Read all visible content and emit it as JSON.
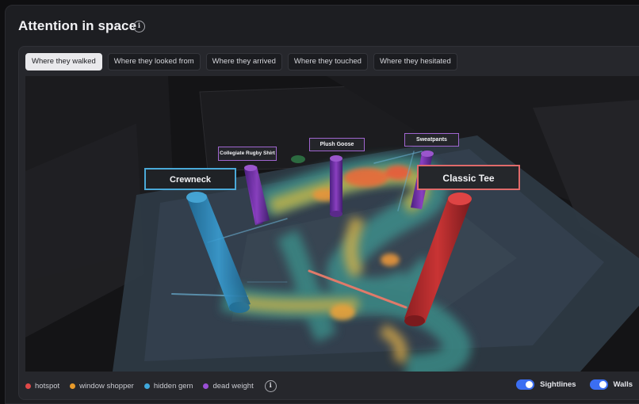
{
  "header": {
    "title": "Attention in space",
    "info_icon": "info-icon"
  },
  "tabs": [
    {
      "label": "Where they walked",
      "active": true
    },
    {
      "label": "Where they looked from",
      "active": false
    },
    {
      "label": "Where they arrived",
      "active": false
    },
    {
      "label": "Where they touched",
      "active": false
    },
    {
      "label": "Where they hesitated",
      "active": false
    }
  ],
  "scene": {
    "products": [
      {
        "label": "Crewneck",
        "category": "hidden gem",
        "color": "#3aa0d6"
      },
      {
        "label": "Collegiate Rugby Shirt",
        "category": "dead weight",
        "color": "#8a3fc0"
      },
      {
        "label": "Plush Goose",
        "category": "dead weight",
        "color": "#8a3fc0"
      },
      {
        "label": "Sweatpants",
        "category": "dead weight",
        "color": "#8a3fc0"
      },
      {
        "label": "Classic Tee",
        "category": "hotspot",
        "color": "#d64545"
      }
    ]
  },
  "legend": {
    "items": [
      {
        "label": "hotspot",
        "color": "#e04848"
      },
      {
        "label": "window shopper",
        "color": "#e89a2a"
      },
      {
        "label": "hidden gem",
        "color": "#3fa8dc"
      },
      {
        "label": "dead weight",
        "color": "#9a4fd6"
      }
    ],
    "info_icon": "info-icon"
  },
  "toggles": {
    "sightlines": {
      "label": "Sightlines",
      "on": true
    },
    "walls": {
      "label": "Walls",
      "on": true
    }
  },
  "colors": {
    "accent": "#3b6ef2",
    "panel": "#1d1e22"
  }
}
